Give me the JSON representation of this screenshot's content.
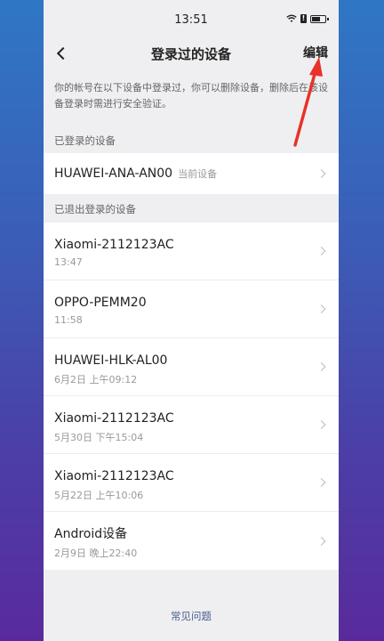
{
  "status_bar": {
    "time": "13:51"
  },
  "nav": {
    "title": "登录过的设备",
    "edit_label": "编辑"
  },
  "description": "你的帐号在以下设备中登录过，你可以删除设备，删除后在该设备登录时需进行安全验证。",
  "logged_in_section": {
    "label": "已登录的设备",
    "device": {
      "name": "HUAWEI-ANA-AN00",
      "tag": "当前设备"
    }
  },
  "logged_out_section": {
    "label": "已退出登录的设备",
    "devices": [
      {
        "name": "Xiaomi-2112123AC",
        "time": "13:47"
      },
      {
        "name": "OPPO-PEMM20",
        "time": "11:58"
      },
      {
        "name": "HUAWEI-HLK-AL00",
        "time": "6月2日 上午09:12"
      },
      {
        "name": "Xiaomi-2112123AC",
        "time": "5月30日 下午15:04"
      },
      {
        "name": "Xiaomi-2112123AC",
        "time": "5月22日 上午10:06"
      },
      {
        "name": "Android设备",
        "time": "2月9日 晚上22:40"
      }
    ]
  },
  "footer": {
    "faq_label": "常见问题"
  },
  "annotation": {
    "arrow_color": "#e8322a"
  },
  "icons": {
    "back": "chevron-left-icon",
    "row": "chevron-right-icon",
    "wifi": "wifi-icon",
    "battery": "battery-icon"
  }
}
